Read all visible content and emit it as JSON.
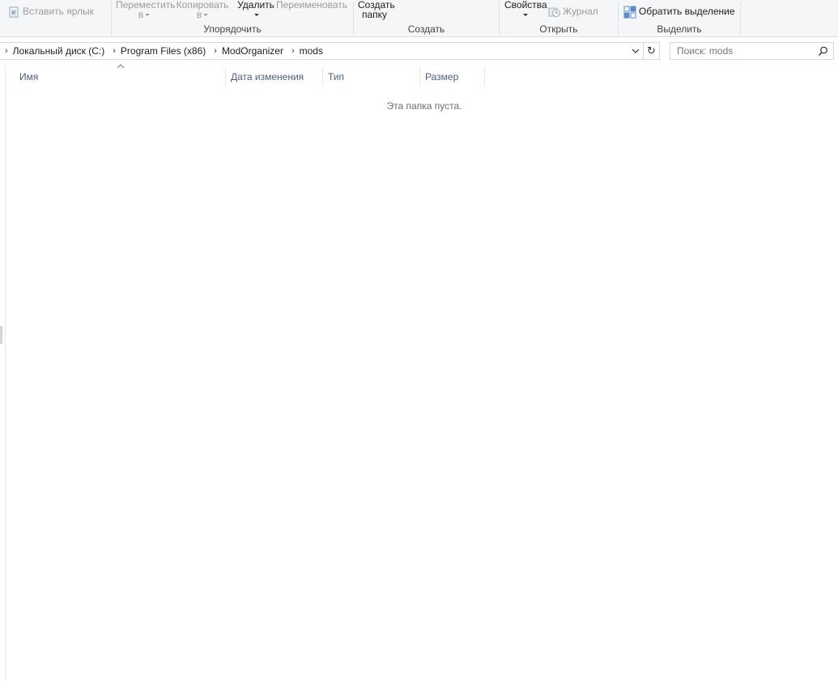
{
  "ribbon": {
    "paste_shortcut": "Вставить ярлык",
    "move_to_line1": "Переместить",
    "move_to_line2": "в",
    "copy_to_line1": "Копировать",
    "copy_to_line2": "в",
    "delete": "Удалить",
    "rename": "Переименовать",
    "organize_label": "Упорядочить",
    "new_folder_line1": "Создать",
    "new_folder_line2": "папку",
    "new_label": "Создать",
    "properties": "Свойства",
    "history": "Журнал",
    "open_label": "Открыть",
    "invert_selection": "Обратить выделение",
    "select_label": "Выделить"
  },
  "address": {
    "crumbs": [
      "Локальный диск (C:)",
      "Program Files (x86)",
      "ModOrganizer",
      "mods"
    ]
  },
  "search": {
    "placeholder": "Поиск: mods"
  },
  "columns": {
    "name": "Имя",
    "date_modified": "Дата изменения",
    "type": "Тип",
    "size": "Размер"
  },
  "empty_message": "Эта папка пуста.",
  "colors": {
    "ribbon_bg": "#f5f6f7",
    "column_header_text": "#4c607a",
    "disabled_text": "#9b9b9b"
  }
}
